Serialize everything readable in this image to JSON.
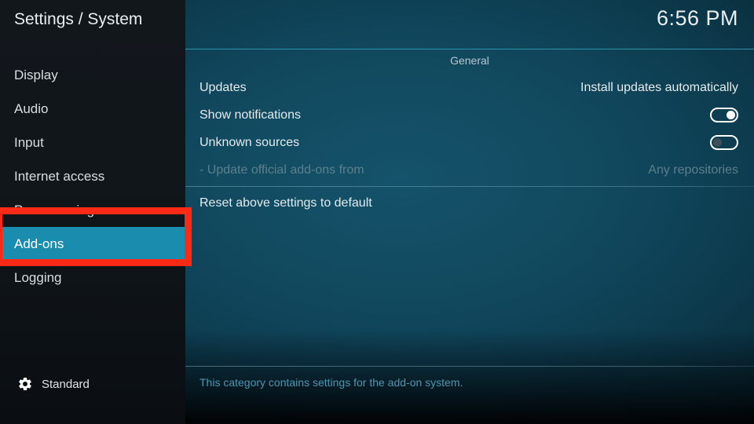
{
  "window": {
    "title": "Settings / System",
    "clock": "6:56 PM"
  },
  "colors": {
    "selection": "#1a8cad",
    "annotation": "#fb2a16",
    "divider": "#2f92ad",
    "panel_text": "#e4ebee",
    "disabled_text": "#5d7f8c",
    "footer_text": "#4e95b0"
  },
  "sidebar": {
    "items": [
      {
        "label": "Display",
        "selected": false
      },
      {
        "label": "Audio",
        "selected": false
      },
      {
        "label": "Input",
        "selected": false
      },
      {
        "label": "Internet access",
        "selected": false
      },
      {
        "label": "Power saving",
        "selected": false
      },
      {
        "label": "Add-ons",
        "selected": true
      },
      {
        "label": "Logging",
        "selected": false
      }
    ],
    "profile": {
      "icon": "gear-icon",
      "label": "Standard"
    }
  },
  "main": {
    "section_header": "General",
    "rows": [
      {
        "label": "Updates",
        "value": "Install updates automatically",
        "control": "value",
        "disabled": false
      },
      {
        "label": "Show notifications",
        "value": "",
        "control": "toggle-on",
        "disabled": false
      },
      {
        "label": "Unknown sources",
        "value": "",
        "control": "toggle-off",
        "disabled": false
      },
      {
        "label": "- Update official add-ons from",
        "value": "Any repositories",
        "control": "value",
        "disabled": true
      },
      {
        "label": "Reset above settings to default",
        "value": "",
        "control": "none",
        "disabled": false
      }
    ],
    "description": "This category contains settings for the add-on system."
  },
  "annotation": {
    "name": "red-highlight-box",
    "targets": "Add-ons"
  }
}
